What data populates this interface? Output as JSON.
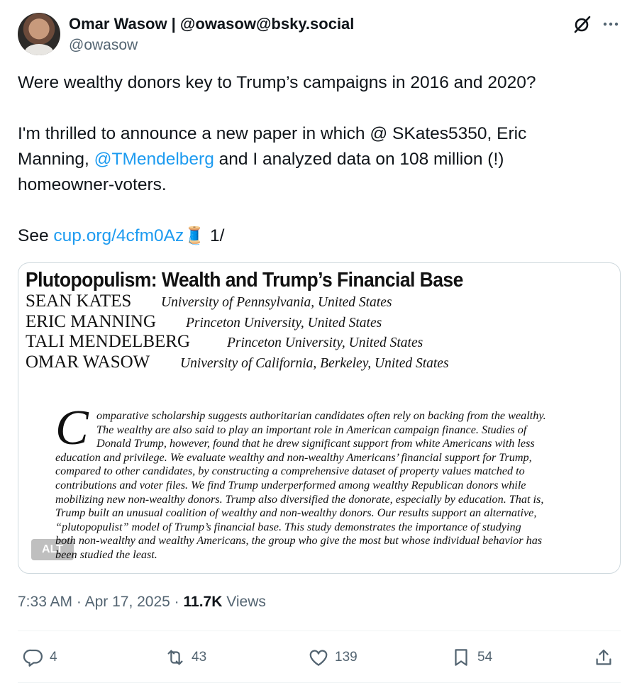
{
  "author": {
    "display_name": "Omar Wasow | @owasow@bsky.social",
    "handle": "@owasow"
  },
  "tweet": {
    "line1": "Were wealthy donors key to Trump’s campaigns in 2016 and 2020?",
    "line2": "I'm thrilled to announce a new paper in which @ SKates5350, Eric",
    "line3_pre": "Manning, ",
    "line3_mention": "@TMendelberg",
    "line3_post": " and I analyzed data on 108 million (!)",
    "line4": "homeowner-voters.",
    "see_label": "See ",
    "link": "cup.org/4cfm0Az",
    "thread_emoji": "🧵",
    "thread_count": " 1/"
  },
  "media": {
    "title": "Plutopopulism: Wealth and Trump’s Financial Base",
    "authors": [
      {
        "name": "SEAN KATES",
        "affiliation": "University of Pennsylvania, United States"
      },
      {
        "name": "ERIC MANNING",
        "affiliation": "Princeton University, United States"
      },
      {
        "name": "TALI MENDELBERG",
        "affiliation": "Princeton University, United States"
      },
      {
        "name": "OMAR WASOW",
        "affiliation": "University of California, Berkeley, United States"
      }
    ],
    "abstract_dropcap": "C",
    "abstract_lines": [
      "omparative scholarship suggests authoritarian candidates often rely on backing from the wealthy.",
      "The wealthy are also said to play an important role in American campaign finance. Studies of",
      "Donald Trump, however, found that he drew significant support from white Americans with less",
      "education and privilege. We evaluate wealthy and non-wealthy Americans’ financial support for Trump,",
      "compared to other candidates, by constructing a comprehensive dataset of property values matched to",
      "contributions and voter files. We find Trump underperformed among wealthy Republican donors while",
      "mobilizing new non-wealthy donors. Trump also diversified the donorate, especially by education. That is,",
      "Trump built an unusual coalition of wealthy and non-wealthy donors. Our results support an alternative,",
      "“plutopopulist” model of Trump’s financial base. This study demonstrates the importance of studying",
      "both non-wealthy and wealthy Americans, the group who give the most but whose individual behavior has",
      "been studied the least."
    ],
    "alt_label": "ALT"
  },
  "meta": {
    "time": "7:33 AM",
    "sep": " · ",
    "date": "Apr 17, 2025",
    "views_count": "11.7K",
    "views_label": " Views"
  },
  "actions": {
    "replies": "4",
    "reposts": "43",
    "likes": "139",
    "bookmarks": "54"
  },
  "colors": {
    "text": "#0f1419",
    "secondary": "#536471",
    "link": "#1d9bf0",
    "border": "#cfd9de"
  },
  "icons": [
    "grok-icon",
    "more-icon",
    "reply-icon",
    "repost-icon",
    "like-icon",
    "bookmark-icon",
    "share-icon"
  ]
}
